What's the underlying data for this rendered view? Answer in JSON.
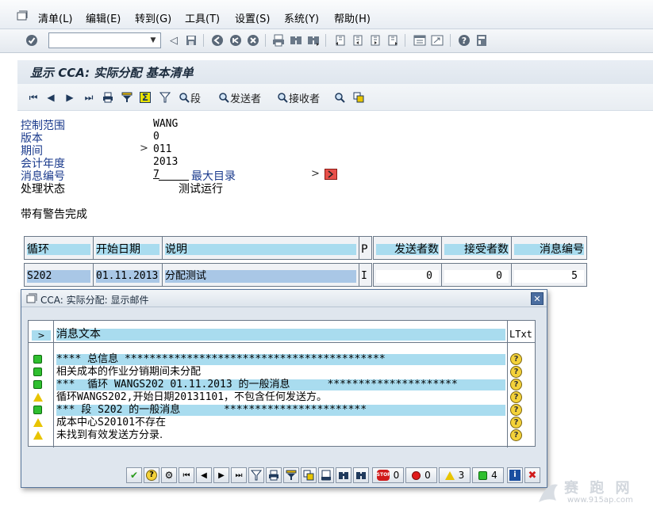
{
  "menubar": {
    "items": [
      "清单(L)",
      "编辑(E)",
      "转到(G)",
      "工具(T)",
      "设置(S)",
      "系统(Y)",
      "帮助(H)"
    ]
  },
  "toolbar": {
    "command_field_value": "",
    "icons": [
      "enter-icon",
      "back-icon",
      "save-icon",
      "exit-icon",
      "cancel-icon",
      "print-icon",
      "find-icon",
      "find-next-icon",
      "first-page-icon",
      "previous-page-icon",
      "next-page-icon",
      "last-page-icon",
      "create-session-icon",
      "shortcut-icon",
      "help-icon",
      "layout-icon"
    ]
  },
  "title": "显示 CCA: 实际分配 基本清单",
  "app_toolbar": {
    "segment_label": "段",
    "sender_label": "发送者",
    "receiver_label": "接收者"
  },
  "header_fields": [
    {
      "label": "控制范围",
      "value": "WANG"
    },
    {
      "label": "版本",
      "value": "0"
    },
    {
      "label": "期间",
      "value": "011"
    },
    {
      "label": "会计年度",
      "value": "2013"
    },
    {
      "label": "消息编号",
      "value": "7",
      "extra": "最大目录"
    },
    {
      "label": "处理状态",
      "value": "测试运行"
    }
  ],
  "status_text": "带有警告完成",
  "grid": {
    "columns": [
      "循环",
      "开始日期",
      "说明",
      "P",
      "发送者数",
      "接受者数",
      "消息编号"
    ],
    "row": [
      "S202",
      "01.11.2013",
      "分配测试",
      "I",
      "0",
      "0",
      "5"
    ]
  },
  "dialog": {
    "title": "CCA: 实际分配: 显示邮件",
    "column_header": "消息文本",
    "ltxt_header": "LTxt",
    "messages": [
      {
        "type": "success",
        "text": "**** 总信息 ******************************************",
        "highlight": true
      },
      {
        "type": "success",
        "text": "相关成本的作业分销期间未分配",
        "highlight": false
      },
      {
        "type": "success",
        "text": "***  循环 WANGS202 01.11.2013 的一般消息      *********************",
        "highlight": true
      },
      {
        "type": "warning",
        "text": "循环WANGS202,开始日期20131101，不包含任何发送方。",
        "highlight": false
      },
      {
        "type": "success",
        "text": "*** 段 S202 的一般消息       ***********************",
        "highlight": true
      },
      {
        "type": "warning",
        "text": "成本中心S20101不存在",
        "highlight": false
      },
      {
        "type": "warning",
        "text": "未找到有效发送方分录.",
        "highlight": false
      }
    ],
    "counts": {
      "all": "0",
      "error": "0",
      "warning": "3",
      "success": "4"
    }
  },
  "watermark": "www.915ap.com",
  "colors": {
    "label_blue": "#1a3a8c",
    "header_cyan": "#a9dcef",
    "dialog_border": "#57759b"
  }
}
